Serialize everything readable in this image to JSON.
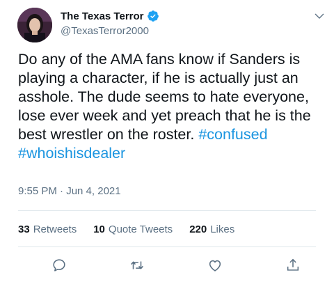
{
  "user": {
    "display_name": "The Texas Terror",
    "handle": "@TexasTerror2000",
    "verified": true,
    "avatar_icon": "profile-photo"
  },
  "tweet": {
    "text": "Do any of the AMA fans know if Sanders is playing a character, if he is actually just an asshole. The dude seems to hate everyone, lose ever week and yet preach that he is the best wrestler on the roster.",
    "hashtags": [
      "#confused",
      "#whoishisdealer"
    ],
    "timestamp": "9:55 PM · Jun 4, 2021"
  },
  "stats": {
    "retweets_count": "33",
    "retweets_label": "Retweets",
    "quote_count": "10",
    "quote_label": "Quote Tweets",
    "likes_count": "220",
    "likes_label": "Likes"
  },
  "actions": [
    "reply-icon",
    "retweet-icon",
    "like-icon",
    "share-icon"
  ],
  "colors": {
    "link": "#1b95e0",
    "secondary_text": "#5b7083",
    "verified_badge": "#1da1f2",
    "divider": "#e1e8ed"
  }
}
